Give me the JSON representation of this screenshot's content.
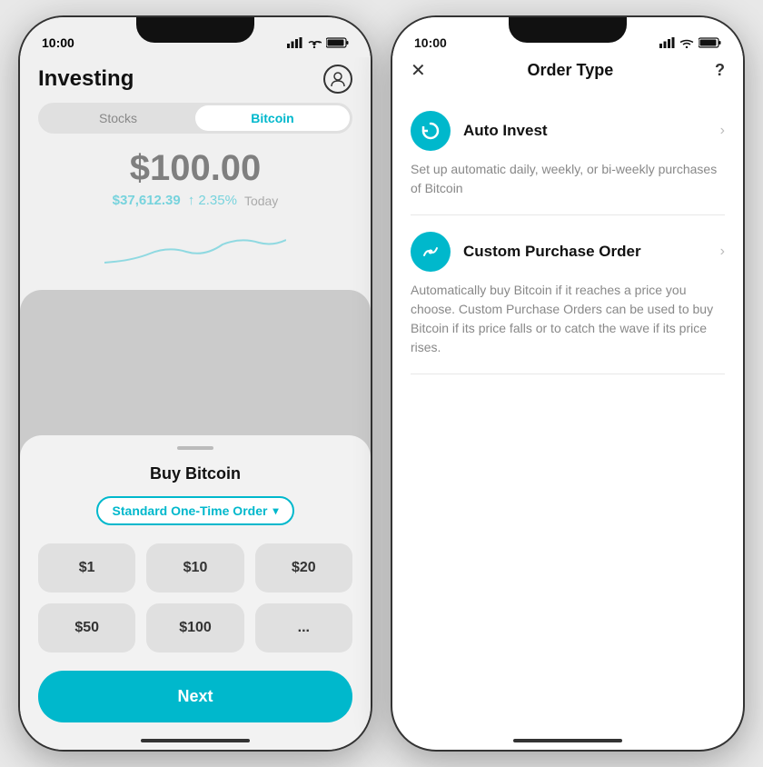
{
  "left_phone": {
    "status_time": "10:00",
    "header_title": "Investing",
    "tabs": [
      "Stocks",
      "Bitcoin"
    ],
    "active_tab": "Bitcoin",
    "main_price": "$100.00",
    "btc_price": "$37,612.39",
    "change": "↑ 2.35%",
    "period": "Today",
    "modal": {
      "title": "Buy Bitcoin",
      "order_type_label": "Standard One-Time Order",
      "amounts": [
        "$1",
        "$10",
        "$20",
        "$50",
        "$100",
        "..."
      ],
      "next_label": "Next"
    }
  },
  "right_phone": {
    "status_time": "10:00",
    "header_title": "Order Type",
    "close_label": "✕",
    "help_label": "?",
    "options": [
      {
        "id": "auto-invest",
        "title": "Auto Invest",
        "icon": "↺",
        "description": "Set up automatic daily, weekly, or bi-weekly purchases of Bitcoin"
      },
      {
        "id": "custom-purchase",
        "title": "Custom Purchase Order",
        "icon": "⤢",
        "description": "Automatically buy Bitcoin if it reaches a price you choose. Custom Purchase Orders can be used to buy Bitcoin if its price falls or to catch the wave if its price rises."
      }
    ]
  }
}
